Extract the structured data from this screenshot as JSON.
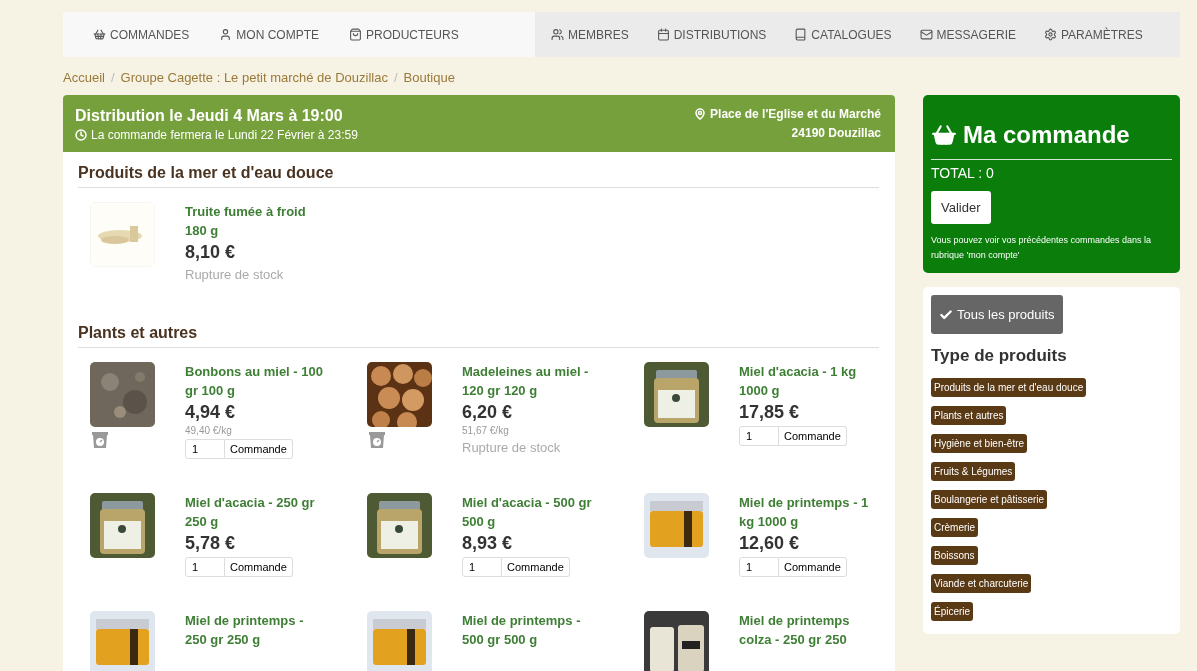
{
  "nav": {
    "left": [
      {
        "label": "COMMANDES"
      },
      {
        "label": "MON COMPTE"
      },
      {
        "label": "PRODUCTEURS"
      }
    ],
    "right": [
      {
        "label": "MEMBRES"
      },
      {
        "label": "DISTRIBUTIONS"
      },
      {
        "label": "CATALOGUES"
      },
      {
        "label": "MESSAGERIE"
      },
      {
        "label": "PARAMÈTRES"
      }
    ]
  },
  "breadcrumb": {
    "separator": "/",
    "items": [
      "Accueil",
      "Groupe Cagette : Le petit marché de Douzillac",
      "Boutique"
    ]
  },
  "distribution": {
    "title": "Distribution le Jeudi 4 Mars à 19:00",
    "closing": "La commande fermera le Lundi 22 Février à 23:59",
    "place": "Place de l'Eglise et du Marché",
    "city": "24190 Douzillac"
  },
  "sections": [
    {
      "title": "Produits de la mer et d'eau douce",
      "products": [
        {
          "name": "Truite fumée à froid 180 g",
          "price": "8,10 €",
          "weighed": false,
          "status": "Rupture de stock"
        }
      ]
    },
    {
      "title": "Plants et autres",
      "products": [
        {
          "name": "Bonbons au miel - 100 gr 100 g",
          "price": "4,94 €",
          "unit_price": "49,40 €/kg",
          "weighed": true,
          "quantity": "1",
          "order": "Commande"
        },
        {
          "name": "Madeleines au miel - 120 gr 120 g",
          "price": "6,20 €",
          "unit_price": "51,67 €/kg",
          "weighed": true,
          "status": "Rupture de stock"
        },
        {
          "name": "Miel d'acacia - 1 kg 1000 g",
          "price": "17,85 €",
          "weighed": false,
          "quantity": "1",
          "order": "Commande"
        },
        {
          "name": "Miel d'acacia - 250 gr 250 g",
          "price": "5,78 €",
          "weighed": false,
          "quantity": "1",
          "order": "Commande"
        },
        {
          "name": "Miel d'acacia - 500 gr 500 g",
          "price": "8,93 €",
          "weighed": false,
          "quantity": "1",
          "order": "Commande"
        },
        {
          "name": "Miel de printemps - 1 kg 1000 g",
          "price": "12,60 €",
          "weighed": false,
          "quantity": "1",
          "order": "Commande"
        },
        {
          "name": "Miel de printemps - 250 gr 250 g",
          "weighed": false
        },
        {
          "name": "Miel de printemps - 500 gr 500 g",
          "weighed": false
        },
        {
          "name": "Miel de printemps colza - 250 gr 250",
          "weighed": false
        }
      ]
    }
  ],
  "cart": {
    "title": "Ma commande",
    "total": "TOTAL : 0",
    "button": "Valider",
    "note": "Vous pouvez voir vos précédentes commandes dans la rubrique 'mon compte'"
  },
  "filters": {
    "all_button": "Tous les produits",
    "title": "Type de produits",
    "tags": [
      "Produits de la mer et d'eau douce",
      "Plants et autres",
      "Hygiène et bien-être",
      "Fruits & Légumes",
      "Boulangerie et pâtisserie",
      "Crèmerie",
      "Boissons",
      "Viande et charcuterie",
      "Épicerie"
    ]
  }
}
